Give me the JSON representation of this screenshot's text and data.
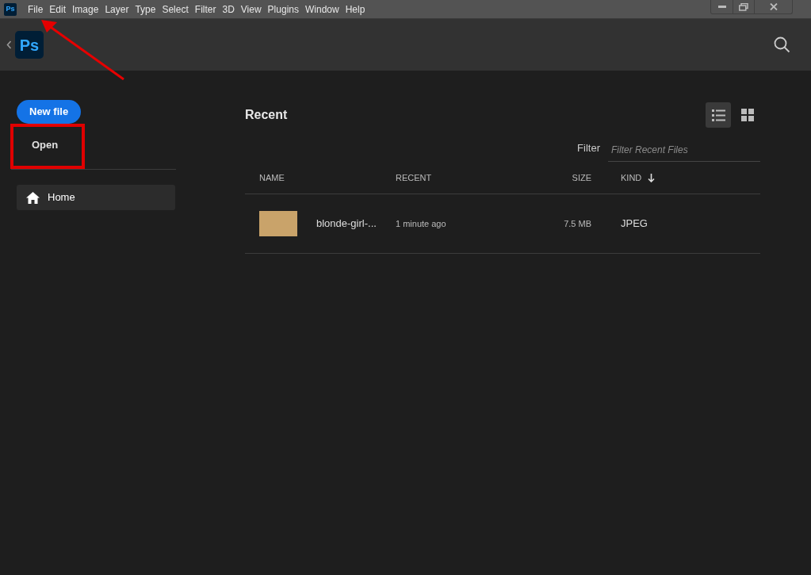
{
  "menu_bar": {
    "app_icon": "Ps",
    "items": [
      "File",
      "Edit",
      "Image",
      "Layer",
      "Type",
      "Select",
      "Filter",
      "3D",
      "View",
      "Plugins",
      "Window",
      "Help"
    ]
  },
  "header": {
    "logo": "Ps"
  },
  "sidebar": {
    "new_file": "New file",
    "open": "Open",
    "open_highlighted": true,
    "items": [
      {
        "label": "Home",
        "selected": true
      }
    ]
  },
  "recent": {
    "title": "Recent",
    "view_toggle": [
      {
        "kind": "list",
        "selected": true
      },
      {
        "kind": "grid",
        "selected": false
      }
    ],
    "filter": {
      "label": "Filter",
      "placeholder": "Filter Recent Files"
    },
    "columns": [
      "NAME",
      "RECENT",
      "SIZE",
      "KIND"
    ],
    "rows": [
      {
        "name": "blonde-girl-...",
        "recent": "1 minute ago",
        "size": "7.5 MB",
        "kind": "JPEG"
      }
    ]
  },
  "annotation_arrow": true
}
